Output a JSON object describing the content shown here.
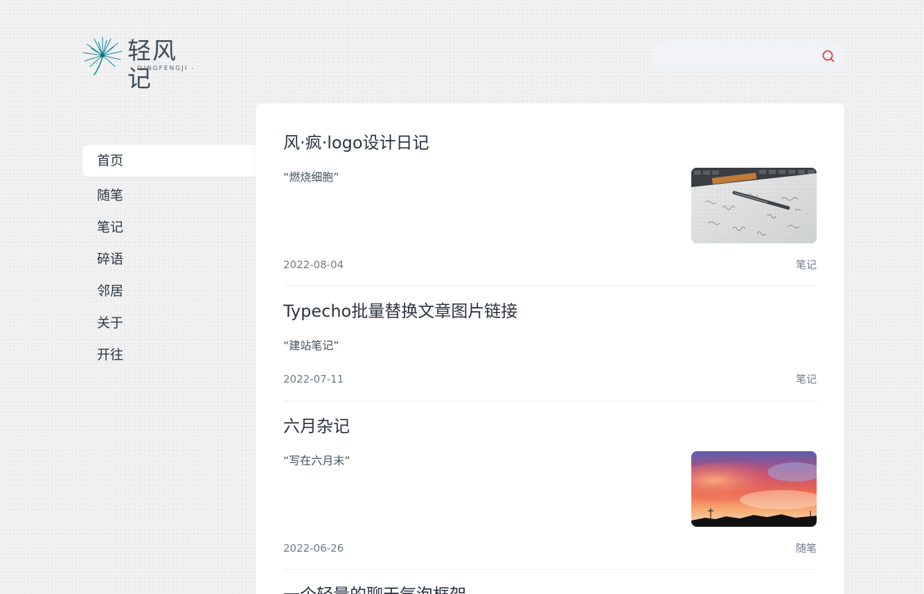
{
  "site": {
    "name": "轻风记",
    "subtitle": "- QINGFENGJI -",
    "accent_color": "#e0353f",
    "logo_color": "#1a8a99"
  },
  "search": {
    "placeholder": "",
    "value": "",
    "icon": "search-icon"
  },
  "nav": {
    "items": [
      {
        "label": "首页",
        "active": true
      },
      {
        "label": "随笔",
        "active": false
      },
      {
        "label": "笔记",
        "active": false
      },
      {
        "label": "碎语",
        "active": false
      },
      {
        "label": "邻居",
        "active": false
      },
      {
        "label": "关于",
        "active": false
      },
      {
        "label": "开往",
        "active": false
      }
    ]
  },
  "posts": [
    {
      "title": "风·疯·logo设计日记",
      "excerpt": "“燃烧细胞”",
      "date": "2022-08-04",
      "category": "笔记",
      "thumbnail": "pen-on-grid-paper"
    },
    {
      "title": "Typecho批量替换文章图片链接",
      "excerpt": "“建站笔记”",
      "date": "2022-07-11",
      "category": "笔记"
    },
    {
      "title": "六月杂记",
      "excerpt": "“写在六月末”",
      "date": "2022-06-26",
      "category": "随笔",
      "thumbnail": "sunset-sky"
    },
    {
      "title": "一个轻量的聊天气泡框架"
    }
  ]
}
